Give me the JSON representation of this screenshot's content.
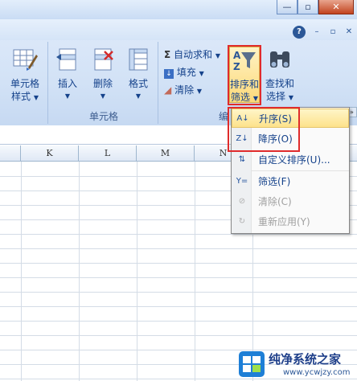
{
  "window": {
    "minimize_label": "—",
    "restore_label": "▫",
    "close_label": "✕"
  },
  "ribbon_small": {
    "help_label": "?",
    "min_label": "–",
    "restore_label": "▫",
    "close_label": "✕"
  },
  "cells_group": {
    "label": "单元格",
    "cell_style": {
      "line1": "单元格",
      "line2": "样式"
    },
    "insert": {
      "label": "插入"
    },
    "delete": {
      "label": "删除"
    },
    "format": {
      "label": "格式"
    }
  },
  "edit_group": {
    "label": "编",
    "autosum": "自动求和",
    "fill": "填充",
    "clear": "清除",
    "sort_filter": {
      "line1": "排序和",
      "line2": "筛选"
    },
    "find_select": {
      "line1": "查找和",
      "line2": "选择"
    }
  },
  "columns": [
    "K",
    "L",
    "M",
    "N"
  ],
  "menu": {
    "items": [
      {
        "label": "升序(S)",
        "icon": "sort-ascending-icon",
        "enabled": true
      },
      {
        "label": "降序(O)",
        "icon": "sort-descending-icon",
        "enabled": true
      },
      {
        "label": "自定义排序(U)...",
        "icon": "custom-sort-icon",
        "enabled": true
      },
      {
        "label": "筛选(F)",
        "icon": "filter-icon",
        "enabled": true
      },
      {
        "label": "清除(C)",
        "icon": "clear-filter-icon",
        "enabled": false
      },
      {
        "label": "重新应用(Y)",
        "icon": "reapply-icon",
        "enabled": false
      }
    ]
  },
  "watermark": {
    "title": "纯净系统之家",
    "url": "www.ycwjzy.com"
  },
  "colors": {
    "highlight": "#e02b2b",
    "ribbon": "#d2e2f6",
    "text": "#15428b"
  }
}
